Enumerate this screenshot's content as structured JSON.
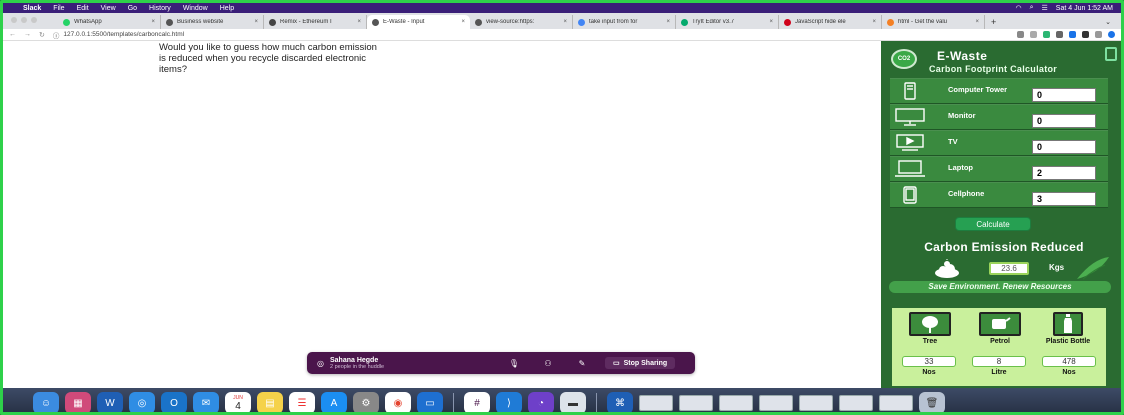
{
  "menubar": {
    "app": "Slack",
    "items": [
      "File",
      "Edit",
      "View",
      "Go",
      "History",
      "Window",
      "Help"
    ],
    "clock": "Sat 4 Jun  1:52 AM"
  },
  "tabs": [
    {
      "title": "WhatsApp",
      "color": "#25d366"
    },
    {
      "title": "Business website",
      "color": "#555555"
    },
    {
      "title": "Remix - Ethereum I",
      "color": "#444444"
    },
    {
      "title": "E-Waste - Input",
      "color": "#555555",
      "active": true
    },
    {
      "title": "view-source:https:",
      "color": "#555555"
    },
    {
      "title": "take input from for",
      "color": "#4285f4"
    },
    {
      "title": "TryIt Editor v3.7",
      "color": "#04aa6d"
    },
    {
      "title": "JavaScript hide ele",
      "color": "#d0021b"
    },
    {
      "title": "html - Get the valu",
      "color": "#f48024"
    }
  ],
  "address": {
    "url": "127.0.0.1:5500/templates/carboncalc.html"
  },
  "page": {
    "question": "Would you like to guess how much carbon emission is reduced when you recycle discarded electronic items?"
  },
  "huddle": {
    "name": "Sahana Hegde",
    "subtitle": "2 people in the huddle",
    "stop_label": "Stop Sharing"
  },
  "calculator": {
    "logo_text": "CO2",
    "title": "E-Waste",
    "subtitle": "Carbon Footprint Calculator",
    "items": [
      {
        "label": "Computer Tower",
        "value": "0",
        "icon": "computer-tower-icon"
      },
      {
        "label": "Monitor",
        "value": "0",
        "icon": "monitor-icon"
      },
      {
        "label": "TV",
        "value": "0",
        "icon": "tv-icon"
      },
      {
        "label": "Laptop",
        "value": "2",
        "icon": "laptop-icon"
      },
      {
        "label": "Cellphone",
        "value": "3",
        "icon": "cellphone-icon"
      }
    ],
    "calculate_label": "Calculate",
    "reduced_title": "Carbon Emission Reduced",
    "result_value": "23.6",
    "result_unit": "Kgs",
    "slogan": "Save Environment. Renew Resources",
    "equivalents": [
      {
        "name": "Tree",
        "value": "33",
        "unit": "Nos",
        "icon": "tree-icon"
      },
      {
        "name": "Petrol",
        "value": "8",
        "unit": "Litre",
        "icon": "petrol-pump-icon"
      },
      {
        "name": "Plastic Bottle",
        "value": "478",
        "unit": "Nos",
        "icon": "plastic-bottle-icon"
      }
    ]
  },
  "dock": {
    "calendar_day": "4",
    "calendar_month": "JUN"
  }
}
